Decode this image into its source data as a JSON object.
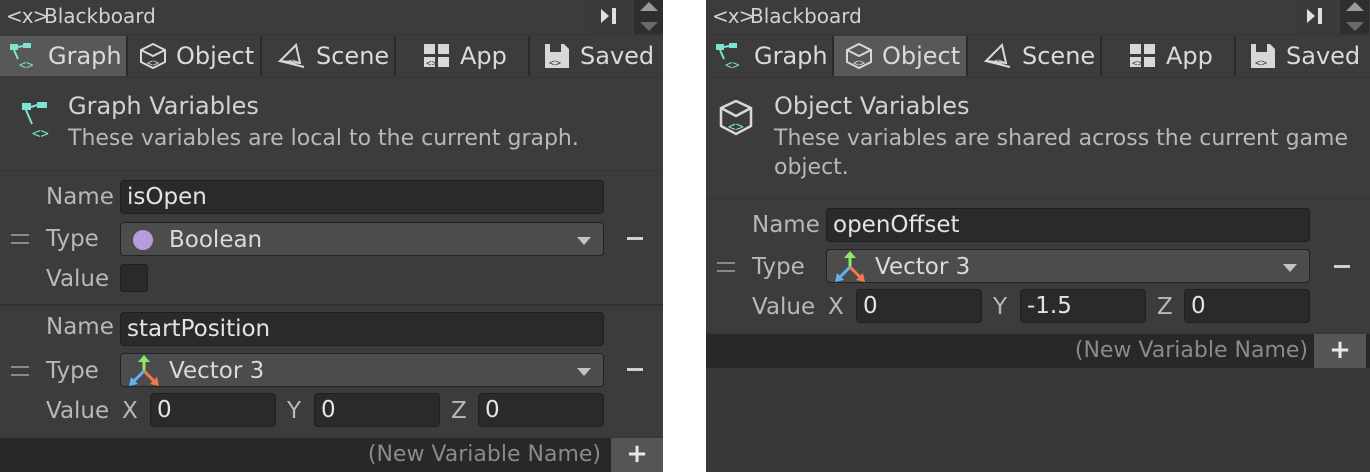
{
  "left_panel": {
    "title_icon": "<x>",
    "title": "Blackboard",
    "tabs": [
      {
        "label": "Graph",
        "icon": "graph-icon",
        "active": true
      },
      {
        "label": "Object",
        "icon": "object-icon",
        "active": false
      },
      {
        "label": "Scene",
        "icon": "scene-icon",
        "active": false
      },
      {
        "label": "App",
        "icon": "app-icon",
        "active": false
      },
      {
        "label": "Saved",
        "icon": "saved-icon",
        "active": false
      }
    ],
    "header": {
      "title": "Graph Variables",
      "description": "These variables are local to the current graph."
    },
    "variables": [
      {
        "name_label": "Name",
        "name": "isOpen",
        "type_label": "Type",
        "type": "Boolean",
        "type_color": "#b39ddb",
        "value_label": "Value"
      },
      {
        "name_label": "Name",
        "name": "startPosition",
        "type_label": "Type",
        "type": "Vector 3",
        "value_label": "Value",
        "x_label": "X",
        "x": "0",
        "y_label": "Y",
        "y": "0",
        "z_label": "Z",
        "z": "0"
      }
    ],
    "new_variable_placeholder": "(New Variable Name)",
    "add_label": "+"
  },
  "right_panel": {
    "title_icon": "<x>",
    "title": "Blackboard",
    "tabs": [
      {
        "label": "Graph",
        "icon": "graph-icon",
        "active": false
      },
      {
        "label": "Object",
        "icon": "object-icon",
        "active": true
      },
      {
        "label": "Scene",
        "icon": "scene-icon",
        "active": false
      },
      {
        "label": "App",
        "icon": "app-icon",
        "active": false
      },
      {
        "label": "Saved",
        "icon": "saved-icon",
        "active": false
      }
    ],
    "header": {
      "title": "Object Variables",
      "description_line1": "These variables are shared across the current game",
      "description_line2": "object."
    },
    "variables": [
      {
        "name_label": "Name",
        "name": "openOffset",
        "type_label": "Type",
        "type": "Vector 3",
        "value_label": "Value",
        "x_label": "X",
        "x": "0",
        "y_label": "Y",
        "y": "-1.5",
        "z_label": "Z",
        "z": "0"
      }
    ],
    "new_variable_placeholder": "(New Variable Name)",
    "add_label": "+"
  },
  "colors": {
    "panel_bg": "#383838",
    "active_tab": "#585858",
    "field_bg": "#2a2a2a",
    "icon_cyan": "#7fe3d3",
    "vector_green": "#8ee66a",
    "vector_blue": "#5fb3f0",
    "vector_red": "#f07a4e"
  }
}
